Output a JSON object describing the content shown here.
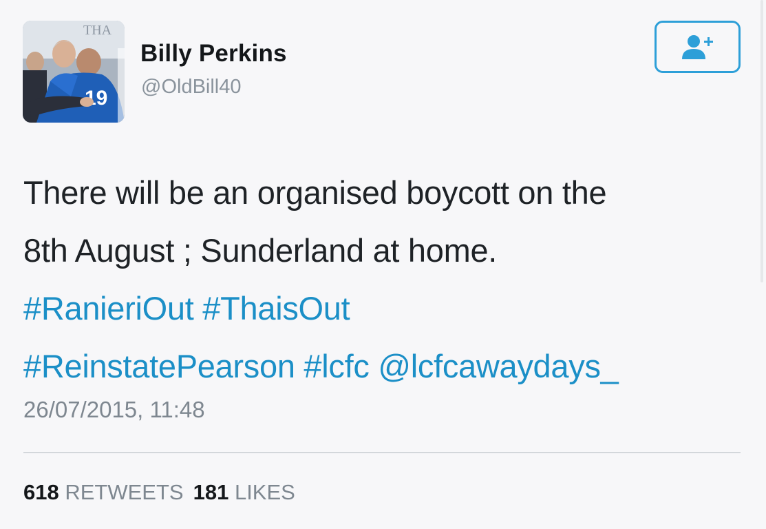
{
  "author": {
    "name": "Billy Perkins",
    "handle": "@OldBill40",
    "avatar_icon": "profile-photo",
    "avatar_overlay_text": "THA",
    "avatar_shirt_number": "19"
  },
  "follow_button": {
    "icon": "add-user-icon",
    "color": "#2d9fd8"
  },
  "tweet": {
    "line1": "There will be an organised boycott on the",
    "line2": "8th August ; Sunderland at home.",
    "tags_line1": [
      {
        "text": "#RanieriOut"
      },
      {
        "text": "#ThaisOut"
      }
    ],
    "tags_line2": [
      {
        "text": "#ReinstatePearson"
      },
      {
        "text": "#lcfc"
      },
      {
        "text": "@lcfcawaydays_"
      }
    ],
    "link_color": "#1b8fc7"
  },
  "timestamp": "26/07/2015, 11:48",
  "stats": {
    "retweets_count": "618",
    "retweets_label": "RETWEETS",
    "likes_count": "181",
    "likes_label": "LIKES"
  }
}
